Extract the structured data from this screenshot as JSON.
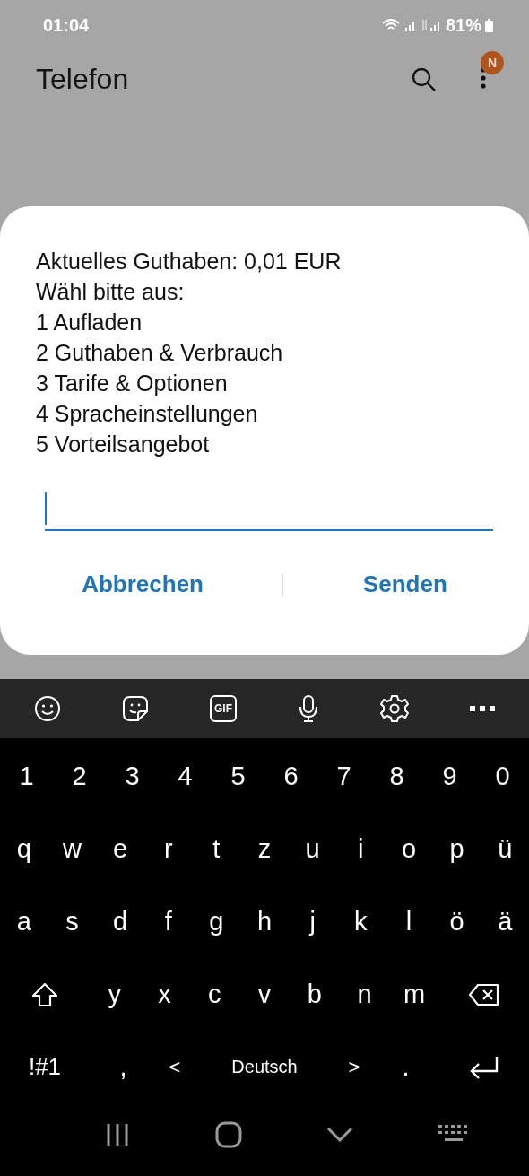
{
  "status_bar": {
    "time": "01:04",
    "battery": "81%"
  },
  "app_bar": {
    "title": "Telefon",
    "badge": "N"
  },
  "dialog": {
    "lines": [
      "Aktuelles Guthaben: 0,01 EUR",
      "Wähl bitte aus:",
      "1 Aufladen",
      "2 Guthaben & Verbrauch",
      "3 Tarife & Optionen",
      "4 Spracheinstellungen",
      "5 Vorteilsangebot"
    ],
    "input": {
      "focused": true
    },
    "buttons": [
      "Abbrechen",
      "Senden"
    ]
  },
  "keyboard": {
    "toolbar": [
      {
        "kind": "emoji"
      },
      {
        "kind": "sticker"
      },
      {
        "kind": "gif",
        "label": "GIF"
      },
      {
        "kind": "mic"
      },
      {
        "kind": "settings"
      },
      {
        "kind": "more"
      }
    ],
    "key_rows": [
      {
        "keys": [
          {
            "kind": "char",
            "label": "1"
          },
          {
            "kind": "char",
            "label": "2"
          },
          {
            "kind": "char",
            "label": "3"
          },
          {
            "kind": "char",
            "label": "4"
          },
          {
            "kind": "char",
            "label": "5"
          },
          {
            "kind": "char",
            "label": "6"
          },
          {
            "kind": "char",
            "label": "7"
          },
          {
            "kind": "char",
            "label": "8"
          },
          {
            "kind": "char",
            "label": "9"
          },
          {
            "kind": "char",
            "label": "0"
          }
        ]
      },
      {
        "keys": [
          {
            "kind": "char",
            "label": "q"
          },
          {
            "kind": "char",
            "label": "w"
          },
          {
            "kind": "char",
            "label": "e"
          },
          {
            "kind": "char",
            "label": "r"
          },
          {
            "kind": "char",
            "label": "t"
          },
          {
            "kind": "char",
            "label": "z"
          },
          {
            "kind": "char",
            "label": "u"
          },
          {
            "kind": "char",
            "label": "i"
          },
          {
            "kind": "char",
            "label": "o"
          },
          {
            "kind": "char",
            "label": "p"
          },
          {
            "kind": "char",
            "label": "ü"
          }
        ]
      },
      {
        "keys": [
          {
            "kind": "char",
            "label": "a"
          },
          {
            "kind": "char",
            "label": "s"
          },
          {
            "kind": "char",
            "label": "d"
          },
          {
            "kind": "char",
            "label": "f"
          },
          {
            "kind": "char",
            "label": "g"
          },
          {
            "kind": "char",
            "label": "h"
          },
          {
            "kind": "char",
            "label": "j"
          },
          {
            "kind": "char",
            "label": "k"
          },
          {
            "kind": "char",
            "label": "l"
          },
          {
            "kind": "char",
            "label": "ö"
          },
          {
            "kind": "char",
            "label": "ä"
          }
        ]
      },
      {
        "keys": [
          {
            "kind": "shift"
          },
          {
            "kind": "char",
            "label": "y"
          },
          {
            "kind": "char",
            "label": "x"
          },
          {
            "kind": "char",
            "label": "c"
          },
          {
            "kind": "char",
            "label": "v"
          },
          {
            "kind": "char",
            "label": "b"
          },
          {
            "kind": "char",
            "label": "n"
          },
          {
            "kind": "char",
            "label": "m"
          },
          {
            "kind": "backspace"
          }
        ]
      },
      {
        "keys": [
          {
            "kind": "symbols",
            "label": "!#1"
          },
          {
            "kind": "char",
            "label": ","
          },
          {
            "kind": "arrow",
            "label": "<"
          },
          {
            "kind": "space",
            "label": "Deutsch"
          },
          {
            "kind": "arrow",
            "label": ">"
          },
          {
            "kind": "char",
            "label": "."
          },
          {
            "kind": "enter"
          }
        ]
      }
    ]
  }
}
